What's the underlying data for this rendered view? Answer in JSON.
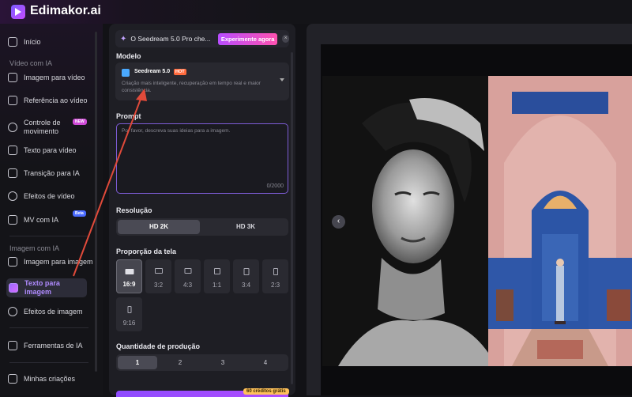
{
  "app": {
    "title": "Edimakor.ai"
  },
  "sidebar": {
    "home": "Início",
    "section_video": "Vídeo com IA",
    "video_items": [
      {
        "label": "Imagem para vídeo"
      },
      {
        "label": "Referência ao vídeo"
      },
      {
        "label": "Controle de movimento",
        "badge": "NEW"
      },
      {
        "label": "Texto para vídeo"
      },
      {
        "label": "Transição para IA"
      },
      {
        "label": "Efeitos de vídeo"
      },
      {
        "label": "MV com IA",
        "badge": "Beta"
      }
    ],
    "section_image": "Imagem com IA",
    "image_items": [
      {
        "label": "Imagem para imagem"
      },
      {
        "label": "Texto para imagem"
      },
      {
        "label": "Efeitos de imagem"
      }
    ],
    "tools": "Ferramentas de IA",
    "creations": "Minhas criações"
  },
  "promo": {
    "text": "O Seedream 5.0 Pro che...",
    "button": "Experimente agora",
    "close": "×"
  },
  "model": {
    "label": "Modelo",
    "name": "Seedream 5.0",
    "tag": "HOT",
    "description": "Criação mais inteligente, recuperação em tempo real e maior consistência."
  },
  "prompt": {
    "label": "Prompt",
    "placeholder": "Por favor, descreva suas ideias para a imagem.",
    "count": "0/2000"
  },
  "resolution": {
    "label": "Resolução",
    "options": [
      "HD 2K",
      "HD 3K"
    ],
    "selected": "HD 2K"
  },
  "aspect": {
    "label": "Proporção da tela",
    "options": [
      "16:9",
      "3:2",
      "4:3",
      "1:1",
      "3:4",
      "2:3",
      "9:16"
    ],
    "selected": "16:9"
  },
  "quantity": {
    "label": "Quantidade de produção",
    "options": [
      "1",
      "2",
      "3",
      "4"
    ],
    "selected": "1"
  },
  "generate": {
    "credits": "60 créditos grátis"
  },
  "colors": {
    "accent": "#8e4bff",
    "promo_button": "#b84dff",
    "hot": "#ff6a3d",
    "prompt_border": "#7d5cd6",
    "annotation_arrow": "#e04a3a"
  }
}
